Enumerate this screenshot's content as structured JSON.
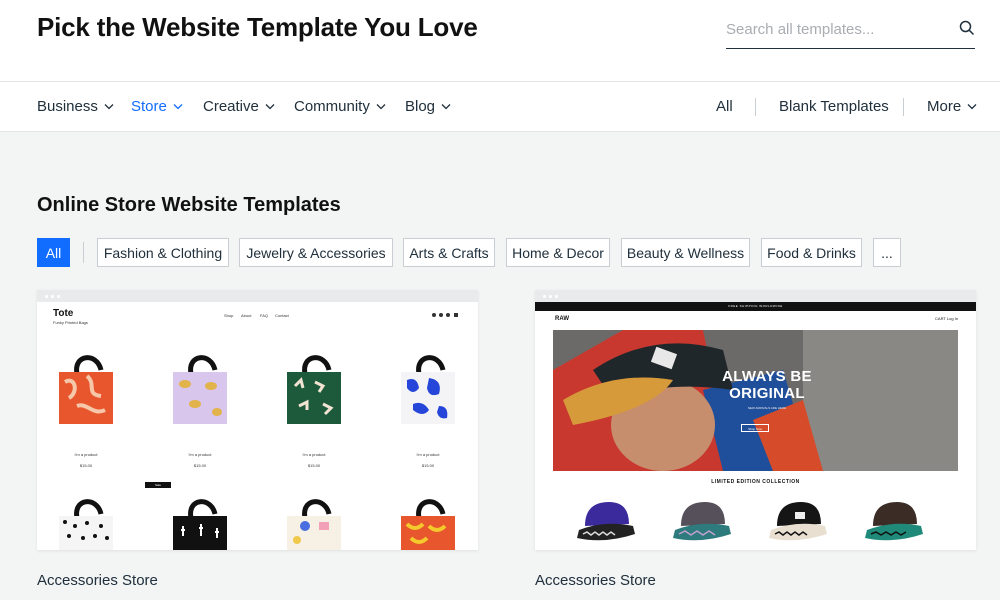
{
  "header": {
    "title": "Pick the Website Template You Love",
    "search_placeholder": "Search all templates...",
    "search_icon": "search-icon"
  },
  "nav": {
    "left": [
      {
        "label": "Business",
        "active": false
      },
      {
        "label": "Store",
        "active": true
      },
      {
        "label": "Creative",
        "active": false
      },
      {
        "label": "Community",
        "active": false
      },
      {
        "label": "Blog",
        "active": false
      }
    ],
    "right": {
      "all": "All",
      "blank": "Blank Templates",
      "more": "More"
    }
  },
  "section": {
    "title": "Online Store Website Templates",
    "filters": [
      "All",
      "Fashion & Clothing",
      "Jewelry & Accessories",
      "Arts & Crafts",
      "Home & Decor",
      "Beauty & Wellness",
      "Food & Drinks",
      "..."
    ],
    "active_filter": "All"
  },
  "templates": [
    {
      "name": "Accessories Store",
      "preview": {
        "logo": "Tote",
        "tagline": "Funky Printed Bags",
        "nav": [
          "Shop",
          "About",
          "FAQ",
          "Contact"
        ],
        "product_name": "I'm a product",
        "price": "$15.00",
        "sale_badge": "Sale"
      }
    },
    {
      "name": "Accessories Store",
      "preview": {
        "banner": "FREE SHIPPING WORLDWIDE",
        "logo": "RAW",
        "icons": "CART  Log In",
        "hero_title": "ALWAYS BE ORIGINAL",
        "hero_sub": "NEW ARRIVALS ARE HERE",
        "hero_button": "Shop Now",
        "collection": "LIMITED EDITION COLLECTION"
      }
    }
  ],
  "colors": {
    "accent": "#116dff",
    "text": "#20303c",
    "background": "#f3f4f4"
  }
}
